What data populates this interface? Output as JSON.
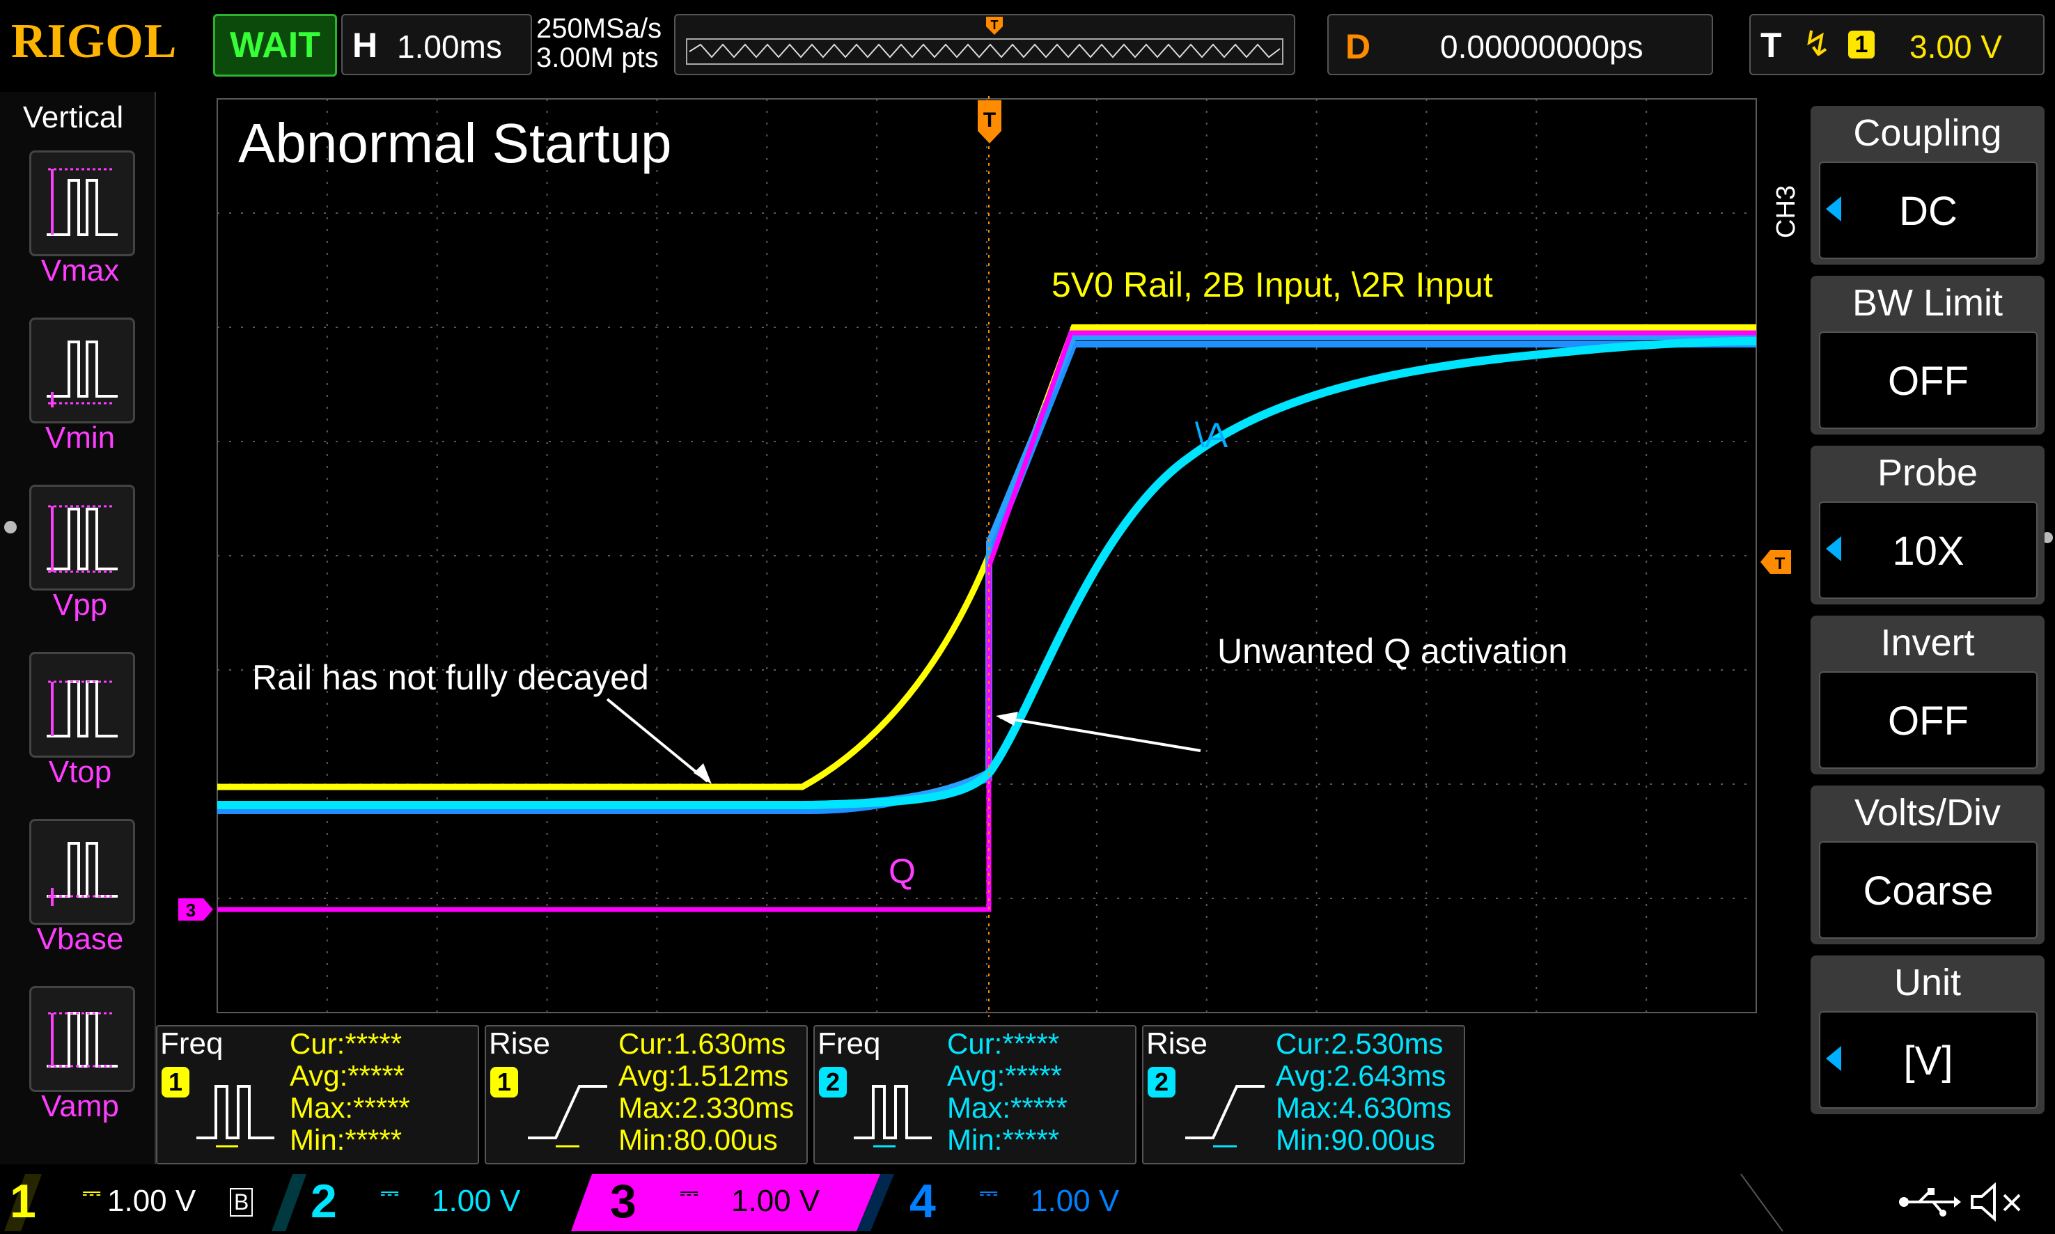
{
  "header": {
    "logo": "RIGOL",
    "run_state": "WAIT",
    "horizontal": {
      "key": "H",
      "value": "1.00ms"
    },
    "sample_rate": "250MSa/s",
    "memory_depth": "3.00M pts",
    "trigger_marker": "T",
    "delay": {
      "key": "D",
      "value": "0.00000000ps"
    },
    "trigger": {
      "key": "T",
      "edge_icon": "rising-edge-icon",
      "source": "1",
      "level": "3.00 V"
    }
  },
  "left_panel": {
    "title": "Vertical",
    "items": [
      {
        "label": "Vmax",
        "icon": "vmax-icon"
      },
      {
        "label": "Vmin",
        "icon": "vmin-icon"
      },
      {
        "label": "Vpp",
        "icon": "vpp-icon"
      },
      {
        "label": "Vtop",
        "icon": "vtop-icon"
      },
      {
        "label": "Vbase",
        "icon": "vbase-icon"
      },
      {
        "label": "Vamp",
        "icon": "vamp-icon"
      }
    ]
  },
  "screen": {
    "title": "Abnormal Startup",
    "annotations": {
      "rails": "5V0 Rail, 2B Input, \\2R Input",
      "a_label": "\\A",
      "q_activation": "Unwanted Q activation",
      "rail_decay": "Rail has not fully decayed",
      "q_label": "Q"
    },
    "trigger_top_marker": "T",
    "ch3_marker": "3",
    "colors": {
      "ch1": "#ffff00",
      "ch2": "#00e5ff",
      "ch3": "#ff00ff",
      "ch4": "#0080ff",
      "trigger": "#ff8c00"
    }
  },
  "right_panel": {
    "channel_tab": "CH3",
    "buttons": [
      {
        "title": "Coupling",
        "value": "DC",
        "arrow": true
      },
      {
        "title": "BW Limit",
        "value": "OFF",
        "arrow": false
      },
      {
        "title": "Probe",
        "value": "10X",
        "arrow": true
      },
      {
        "title": "Invert",
        "value": "OFF",
        "arrow": false
      },
      {
        "title": "Volts/Div",
        "value": "Coarse",
        "arrow": false
      },
      {
        "title": "Unit",
        "value": "[V]",
        "arrow": true
      }
    ]
  },
  "measurements": [
    {
      "name": "Freq",
      "channel": "1",
      "color": "#ffff00",
      "cur": "Cur:*****",
      "avg": "Avg:*****",
      "max": "Max:*****",
      "min": "Min:*****"
    },
    {
      "name": "Rise",
      "channel": "1",
      "color": "#ffff00",
      "cur": "Cur:1.630ms",
      "avg": "Avg:1.512ms",
      "max": "Max:2.330ms",
      "min": "Min:80.00us"
    },
    {
      "name": "Freq",
      "channel": "2",
      "color": "#00e5ff",
      "cur": "Cur:*****",
      "avg": "Avg:*****",
      "max": "Max:*****",
      "min": "Min:*****"
    },
    {
      "name": "Rise",
      "channel": "2",
      "color": "#00e5ff",
      "cur": "Cur:2.530ms",
      "avg": "Avg:2.643ms",
      "max": "Max:4.630ms",
      "min": "Min:90.00us"
    }
  ],
  "channels": [
    {
      "num": "1",
      "scale": "1.00 V",
      "bw": "B",
      "color": "#ffff00"
    },
    {
      "num": "2",
      "scale": "1.00 V",
      "color": "#00e5ff"
    },
    {
      "num": "3",
      "scale": "1.00 V",
      "color": "#ff00ff"
    },
    {
      "num": "4",
      "scale": "1.00 V",
      "color": "#0080ff"
    }
  ],
  "status_icons": [
    "usb-icon",
    "sound-muted-icon"
  ]
}
